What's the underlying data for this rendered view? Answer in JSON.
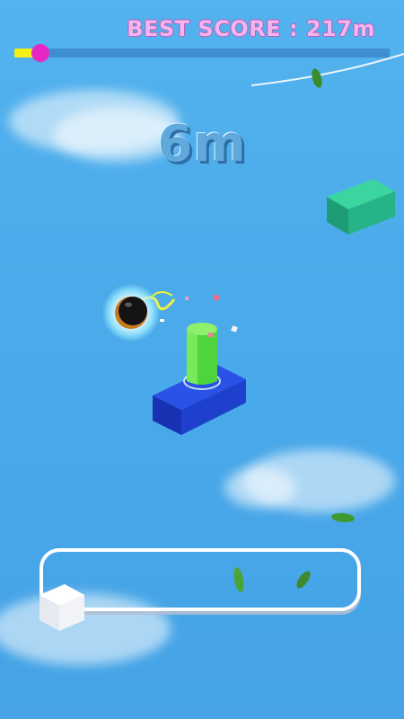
{
  "hud": {
    "best_score_label": "BEST SCORE",
    "best_score_value": "217m",
    "progress_fraction": 0.07,
    "distance_label": "6m",
    "colors": {
      "best_score": "#f2b6ee",
      "progress_fill": "#f5f016",
      "progress_knob": "#e727c4"
    }
  },
  "scene": {
    "ball": "black-ball-icon",
    "obstacle": "green-pillar",
    "platform": "blue-block",
    "distant_block": "teal-block",
    "leaves": "leaf-icon"
  },
  "controls": {
    "input_panel": "tap-panel"
  }
}
